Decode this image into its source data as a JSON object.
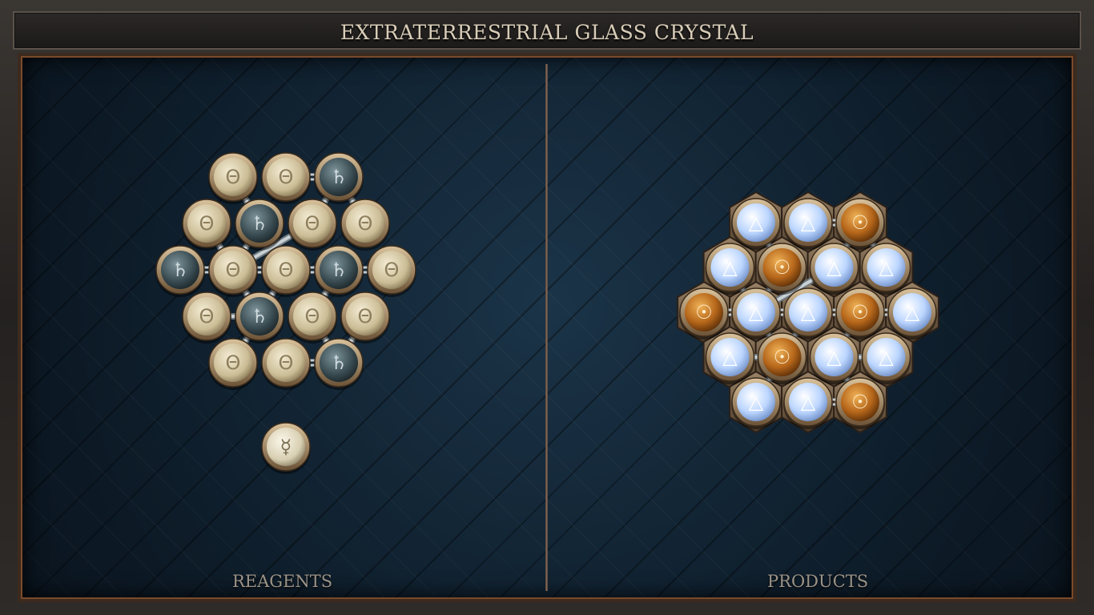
{
  "title": "EXTRATERRESTRIAL GLASS CRYSTAL",
  "panels": {
    "reagents_label": "REAGENTS",
    "products_label": "PRODUCTS"
  },
  "colors": {
    "salt": "#d8ccaa",
    "lead": "#3e5056",
    "air": "#cfe3ff",
    "gold": "#c87a1f",
    "quicksilver": "#e3dcc4"
  },
  "reagents": {
    "atoms": [
      {
        "name": "salt",
        "glyph": "Θ"
      },
      {
        "name": "salt",
        "glyph": "Θ"
      },
      {
        "name": "lead",
        "glyph": "♄"
      },
      {
        "name": "salt",
        "glyph": "Θ"
      },
      {
        "name": "lead",
        "glyph": "♄"
      },
      {
        "name": "salt",
        "glyph": "Θ"
      },
      {
        "name": "salt",
        "glyph": "Θ"
      },
      {
        "name": "lead",
        "glyph": "♄"
      },
      {
        "name": "salt",
        "glyph": "Θ"
      },
      {
        "name": "salt",
        "glyph": "Θ"
      },
      {
        "name": "lead",
        "glyph": "♄"
      },
      {
        "name": "salt",
        "glyph": "Θ"
      },
      {
        "name": "salt",
        "glyph": "Θ"
      },
      {
        "name": "lead",
        "glyph": "♄"
      },
      {
        "name": "salt",
        "glyph": "Θ"
      },
      {
        "name": "salt",
        "glyph": "Θ"
      },
      {
        "name": "salt",
        "glyph": "Θ"
      },
      {
        "name": "salt",
        "glyph": "Θ"
      },
      {
        "name": "lead",
        "glyph": "♄"
      }
    ],
    "extra_atom": {
      "name": "quicksilver",
      "glyph": "☿"
    }
  },
  "products": {
    "atoms": [
      {
        "name": "air",
        "glyph": "△"
      },
      {
        "name": "air",
        "glyph": "△"
      },
      {
        "name": "gold",
        "glyph": "☉"
      },
      {
        "name": "air",
        "glyph": "△"
      },
      {
        "name": "gold",
        "glyph": "☉"
      },
      {
        "name": "air",
        "glyph": "△"
      },
      {
        "name": "air",
        "glyph": "△"
      },
      {
        "name": "gold",
        "glyph": "☉"
      },
      {
        "name": "air",
        "glyph": "△"
      },
      {
        "name": "air",
        "glyph": "△"
      },
      {
        "name": "gold",
        "glyph": "☉"
      },
      {
        "name": "air",
        "glyph": "△"
      },
      {
        "name": "air",
        "glyph": "△"
      },
      {
        "name": "gold",
        "glyph": "☉"
      },
      {
        "name": "air",
        "glyph": "△"
      },
      {
        "name": "air",
        "glyph": "△"
      },
      {
        "name": "air",
        "glyph": "△"
      },
      {
        "name": "air",
        "glyph": "△"
      },
      {
        "name": "gold",
        "glyph": "☉"
      }
    ]
  }
}
